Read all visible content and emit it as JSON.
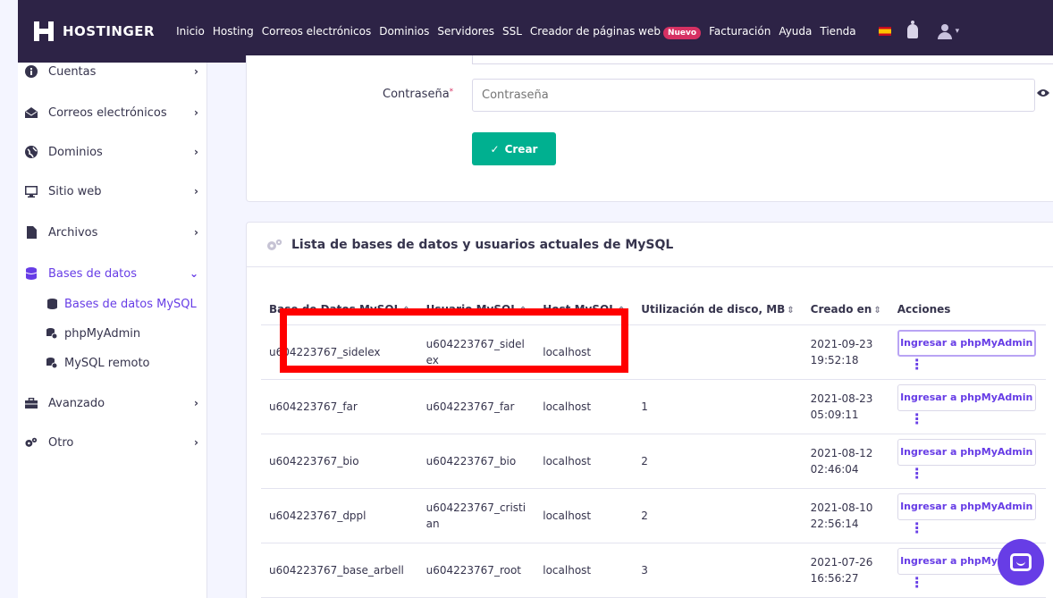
{
  "brand": {
    "name": "HOSTINGER"
  },
  "nav": {
    "items": [
      "Inicio",
      "Hosting",
      "Correos electrónicos",
      "Dominios",
      "Servidores",
      "SSL",
      "Creador de páginas web"
    ],
    "badge": "Nuevo",
    "items_after": [
      "Facturación",
      "Ayuda",
      "Tienda"
    ]
  },
  "sidebar": {
    "items": [
      {
        "label": "Cuentas",
        "icon": "info-icon"
      },
      {
        "label": "Correos electrónicos",
        "icon": "mail-icon"
      },
      {
        "label": "Dominios",
        "icon": "globe-icon"
      },
      {
        "label": "Sitio web",
        "icon": "monitor-icon"
      },
      {
        "label": "Archivos",
        "icon": "file-icon"
      },
      {
        "label": "Bases de datos",
        "icon": "database-icon"
      },
      {
        "label": "Avanzado",
        "icon": "toolbox-icon"
      },
      {
        "label": "Otro",
        "icon": "cogs-icon"
      }
    ],
    "sub_items": [
      {
        "label": "Bases de datos MySQL",
        "icon": "database-icon"
      },
      {
        "label": "phpMyAdmin",
        "icon": "database-settings-icon"
      },
      {
        "label": "MySQL remoto",
        "icon": "database-settings-icon"
      }
    ]
  },
  "form": {
    "password_label": "Contraseña",
    "password_placeholder": "Contraseña",
    "create_label": "Crear"
  },
  "list": {
    "title": "Lista de bases de datos y usuarios actuales de MySQL",
    "headers": {
      "db": "Base de Datos MySQL",
      "user": "Usuario MySQL",
      "host": "Host MySQL",
      "disk": "Utilización de disco, MB",
      "created": "Creado en",
      "actions": "Acciones"
    },
    "rows": [
      {
        "db": "u604223767_sidelex",
        "user": "u604223767_sidelex",
        "host": "localhost",
        "disk": "",
        "date": "2021-09-23",
        "time": "19:52:18",
        "action": "Ingresar a phpMyAdmin"
      },
      {
        "db": "u604223767_far",
        "user": "u604223767_far",
        "host": "localhost",
        "disk": "1",
        "date": "2021-08-23",
        "time": "05:09:11",
        "action": "Ingresar a phpMyAdmin"
      },
      {
        "db": "u604223767_bio",
        "user": "u604223767_bio",
        "host": "localhost",
        "disk": "2",
        "date": "2021-08-12",
        "time": "02:46:04",
        "action": "Ingresar a phpMyAdmin"
      },
      {
        "db": "u604223767_dppl",
        "user": "u604223767_cristian",
        "host": "localhost",
        "disk": "2",
        "date": "2021-08-10",
        "time": "22:56:14",
        "action": "Ingresar a phpMyAdmin"
      },
      {
        "db": "u604223767_base_arbell",
        "user": "u604223767_root",
        "host": "localhost",
        "disk": "3",
        "date": "2021-07-26",
        "time": "16:56:27",
        "action": "Ingresar a phpMyAdmin"
      }
    ]
  },
  "colors": {
    "accent": "#673de6",
    "nav_bg": "#2d2346",
    "create": "#00b090",
    "highlight": "#ff0000"
  }
}
